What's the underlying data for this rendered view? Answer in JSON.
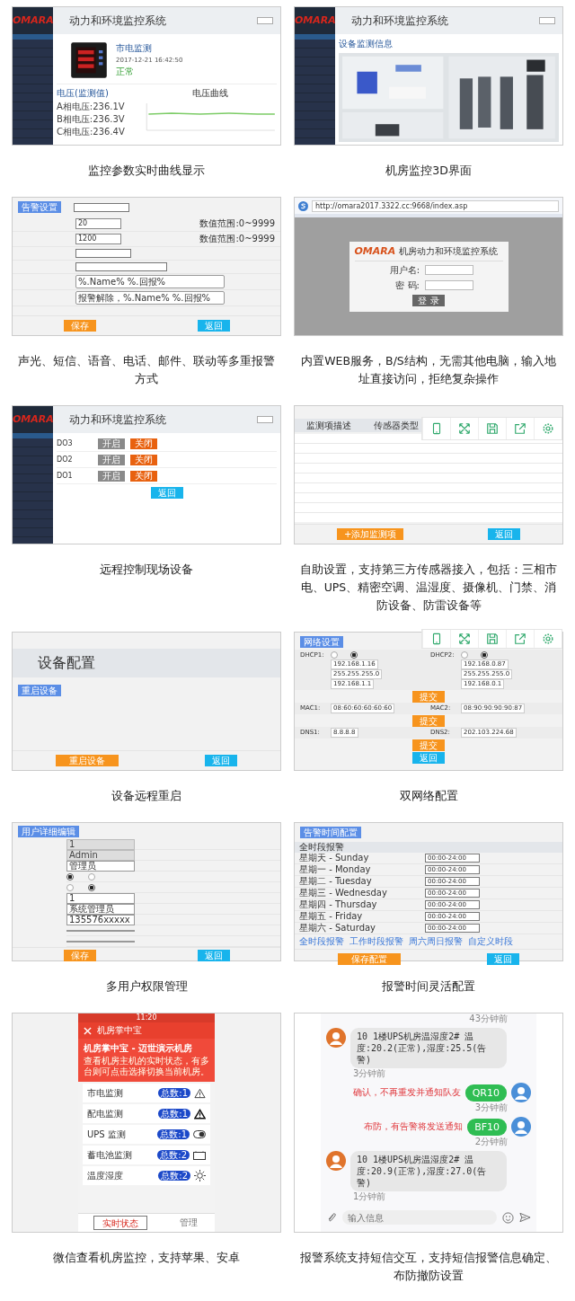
{
  "panels": [
    {
      "kind": "monitor",
      "logo": "OMARA",
      "title": "动力和环境监控系统",
      "section": "市电监测",
      "date": "2017-12-21 16:42:50",
      "status": "正常",
      "readings_title": "电压(监测值)",
      "readings": [
        "A相电压:236.1V",
        "B相电压:236.3V",
        "C相电压:236.4V"
      ],
      "chart_title": "电压曲线",
      "caption": "监控参数实时曲线显示"
    },
    {
      "kind": "room3d",
      "logo": "OMARA",
      "title": "动力和环境监控系统",
      "section": "设备监测信息",
      "caption": "机房监控3D界面"
    },
    {
      "kind": "alarm_form",
      "tag": "告警设置",
      "fields": [
        {
          "value": "20",
          "hint": "数值范围:0~9999"
        },
        {
          "value": "1200",
          "hint": "数值范围:0~9999"
        }
      ],
      "texts": [
        "%.Name% %.回报%",
        "报警解除，%.Name% %.回报%"
      ],
      "buttons": [
        "保存",
        "返回"
      ],
      "caption": "声光、短信、语音、电话、邮件、联动等多重报警方式"
    },
    {
      "kind": "login",
      "url": "http://omara2017.3322.cc:9668/index.asp",
      "logo": "OMARA",
      "title": "机房动力和环境监控系统",
      "fields": [
        {
          "label": "用户名:"
        },
        {
          "label": "密 码:"
        }
      ],
      "button": "登 录",
      "caption": "内置WEB服务，B/S结构，无需其他电脑，输入地址直接访问，拒绝复杂操作"
    },
    {
      "kind": "remote",
      "logo": "OMARA",
      "title": "动力和环境监控系统",
      "outputs": [
        {
          "name": "DO3",
          "buttons": [
            "开启",
            "关闭"
          ],
          "on": false
        },
        {
          "name": "DO2",
          "buttons": [
            "开启",
            "关闭"
          ],
          "on": false
        },
        {
          "name": "DO1",
          "buttons": [
            "开启",
            "关闭"
          ],
          "on": false
        }
      ],
      "back": "返回",
      "caption": "远程控制现场设备"
    },
    {
      "kind": "sensors",
      "columns": [
        "监测项描述",
        "传感器类型"
      ],
      "buttons": [
        "+添加监测项",
        "返回"
      ],
      "caption": "自助设置，支持第三方传感器接入，包括：三相市电、UPS、精密空调、温湿度、摄像机、门禁、消防设备、防雷设备等"
    },
    {
      "kind": "restart",
      "title": "设备配置",
      "tag": "重启设备",
      "buttons": [
        "重启设备",
        "返回"
      ],
      "caption": "设备远程重启"
    },
    {
      "kind": "network",
      "tag": "网络设置",
      "dhcp": [
        {
          "label": "DHCP1:",
          "options": [
            {
              "selected": false
            },
            {
              "selected": true
            }
          ]
        },
        {
          "label": "DHCP2:",
          "options": [
            {
              "selected": false
            },
            {
              "selected": true
            }
          ]
        }
      ],
      "rows": [
        [
          "192.168.1.16",
          "192.168.0.87"
        ],
        [
          "255.255.255.0",
          "255.255.255.0"
        ],
        [
          "192.168.1.1",
          "192.168.0.1"
        ]
      ],
      "macs": [
        {
          "label": "MAC1:",
          "value": "08:60:60:60:60:60"
        },
        {
          "label": "MAC2:",
          "value": "08:90:90:90:90:87"
        }
      ],
      "dns": [
        {
          "label": "DNS1:",
          "value": "8.8.8.8"
        },
        {
          "label": "DNS2:",
          "value": "202.103.224.68"
        }
      ],
      "submit": [
        "提交",
        "提交",
        "提交"
      ],
      "back": "返回",
      "caption": "双网络配置"
    },
    {
      "kind": "users",
      "tag": "用户详细编辑",
      "fields": [
        {
          "kind": "input",
          "value": "1",
          "disabled": true
        },
        {
          "kind": "input",
          "value": "Admin",
          "disabled": true
        },
        {
          "kind": "input",
          "value": "管理员",
          "disabled": false
        },
        {
          "kind": "radio",
          "options": [
            {
              "selected": true
            },
            {
              "selected": false
            }
          ]
        },
        {
          "kind": "radio",
          "options": [
            {
              "selected": false
            },
            {
              "selected": true
            }
          ]
        },
        {
          "kind": "select",
          "value": "1"
        },
        {
          "kind": "input",
          "value": "系统管理员",
          "disabled": false
        },
        {
          "kind": "input",
          "value": "135576xxxxx",
          "disabled": false
        },
        {
          "kind": "input",
          "disabled": false
        },
        {
          "kind": "input",
          "disabled": false
        }
      ],
      "buttons": [
        "保存",
        "返回"
      ],
      "caption": "多用户权限管理"
    },
    {
      "kind": "schedule",
      "tag": "告警时间配置",
      "header": "全时段报警",
      "days": [
        {
          "label": "星期天 - Sunday",
          "value": "00:00-24:00"
        },
        {
          "label": "星期一 - Monday",
          "value": "00:00-24:00"
        },
        {
          "label": "星期二 - Tuesday",
          "value": "00:00-24:00"
        },
        {
          "label": "星期三 - Wednesday",
          "value": "00:00-24:00"
        },
        {
          "label": "星期四 - Thursday",
          "value": "00:00-24:00"
        },
        {
          "label": "星期五 - Friday",
          "value": "00:00-24:00"
        },
        {
          "label": "星期六 - Saturday",
          "value": "00:00-24:00"
        }
      ],
      "links": [
        "全时段报警",
        "工作时段报警",
        "周六周日报警",
        "自定义时段"
      ],
      "buttons": [
        "保存配置",
        "返回"
      ],
      "caption": "报警时间灵活配置"
    },
    {
      "kind": "wechat",
      "time": "11:20",
      "app_title": "机房掌中宝",
      "hero_title": "机房掌中宝 - 迈世演示机房",
      "hero_text": "查看机房主机的实时状态，有多台则可点击选择切换当前机房。",
      "items": [
        {
          "label": "市电监测",
          "count": "总数:1"
        },
        {
          "label": "配电监测",
          "count": "总数:1"
        },
        {
          "label": "UPS 监测",
          "count": "总数:1"
        },
        {
          "label": "蓄电池监测",
          "count": "总数:2"
        },
        {
          "label": "温度湿度",
          "count": "总数:2"
        }
      ],
      "tabs": [
        {
          "label": "实时状态",
          "selected": true
        },
        {
          "label": "管理",
          "selected": false
        }
      ],
      "caption": "微信查看机房监控，支持苹果、安卓"
    },
    {
      "kind": "sms",
      "top_time": "43分钟前",
      "messages": [
        {
          "kind": "incoming",
          "text": "10 1楼UPS机房温湿度2# 温度:20.2(正常),湿度:25.5(告警)",
          "time": "3分钟前"
        },
        {
          "kind": "outgoing",
          "note": "确认，不再重发并通知队友",
          "text": "QR10",
          "time": "3分钟前"
        },
        {
          "kind": "outgoing",
          "note": "布防，有告警将发送通知",
          "text": "BF10",
          "time": "2分钟前"
        },
        {
          "kind": "incoming",
          "text": "10 1楼UPS机房温湿度2# 温度:20.9(正常),湿度:27.0(告警)",
          "time": "1分钟前"
        }
      ],
      "placeholder": "输入信息",
      "caption": "报警系统支持短信交互，支持短信报警信息确定、布防撤防设置"
    }
  ]
}
